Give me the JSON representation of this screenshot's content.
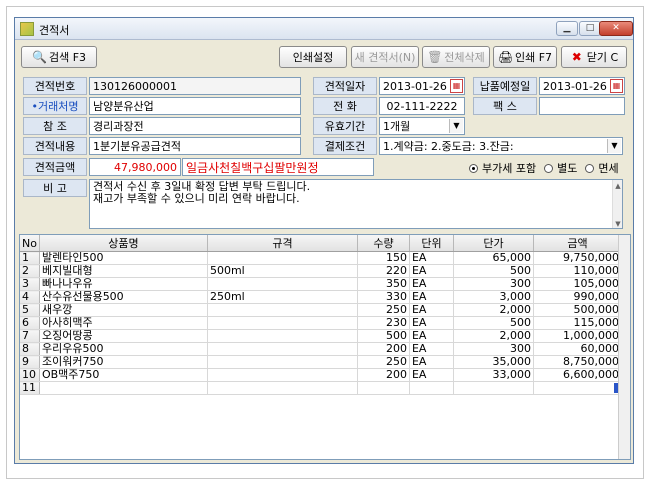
{
  "window": {
    "title": "견적서"
  },
  "toolbar": {
    "search": "검색 F3",
    "print_setup": "인쇄설정",
    "new_quote": "새 견적서(N)",
    "delete_all": "전체삭제",
    "print": "인쇄 F7",
    "close": "닫기 C"
  },
  "form": {
    "quote_no_label": "견적번호",
    "quote_no": "130126000001",
    "client_label": "•거래처명",
    "client": "남양분유산업",
    "ref_label": "참 조",
    "ref": "경리과장전",
    "content_label": "견적내용",
    "content": "1분기분유공급견적",
    "amount_label": "견적금액",
    "amount": "47,980,000",
    "amount_korean": "일금사천칠백구십팔만원정",
    "note_label": "비 고",
    "note_lines": [
      "견적서 수신 후 3일내 확정 답변 부탁 드립니다.",
      "재고가 부족할 수 있으니 미리 연락 바랍니다."
    ],
    "date_label": "견적일자",
    "date": "2013-01-26",
    "phone_label": "전 화",
    "phone": "02-111-2222",
    "validity_label": "유효기간",
    "validity": "1개월",
    "payment_label": "결제조건",
    "payment": "1.계약금:  2.중도금:  3.잔금:",
    "delivery_label": "납품예정일",
    "delivery": "2013-01-26",
    "fax_label": "팩 스",
    "fax": "",
    "vat": {
      "include": "부가세 포함",
      "separate": "별도",
      "exempt": "면세"
    }
  },
  "grid": {
    "headers": [
      "No",
      "상품명",
      "규격",
      "수량",
      "단위",
      "단가",
      "금액"
    ],
    "rows": [
      [
        "1",
        "발렌타인500",
        "",
        "150",
        "EA",
        "65,000",
        "9,750,000"
      ],
      [
        "2",
        "베지빌대형",
        "500ml",
        "220",
        "EA",
        "500",
        "110,000"
      ],
      [
        "3",
        "빠나나우유",
        "",
        "350",
        "EA",
        "300",
        "105,000"
      ],
      [
        "4",
        "산수유선물용500",
        "250ml",
        "330",
        "EA",
        "3,000",
        "990,000"
      ],
      [
        "5",
        "새우깡",
        "",
        "250",
        "EA",
        "2,000",
        "500,000"
      ],
      [
        "6",
        "아사히맥주",
        "",
        "230",
        "EA",
        "500",
        "115,000"
      ],
      [
        "7",
        "오징어땅콩",
        "",
        "500",
        "EA",
        "2,000",
        "1,000,000"
      ],
      [
        "8",
        "우리우유500",
        "",
        "200",
        "EA",
        "300",
        "60,000"
      ],
      [
        "9",
        "조이워커750",
        "",
        "250",
        "EA",
        "35,000",
        "8,750,000"
      ],
      [
        "10",
        "OB맥주750",
        "",
        "200",
        "EA",
        "33,000",
        "6,600,000"
      ],
      [
        "11",
        "",
        "",
        "",
        "",
        "",
        ""
      ]
    ]
  }
}
